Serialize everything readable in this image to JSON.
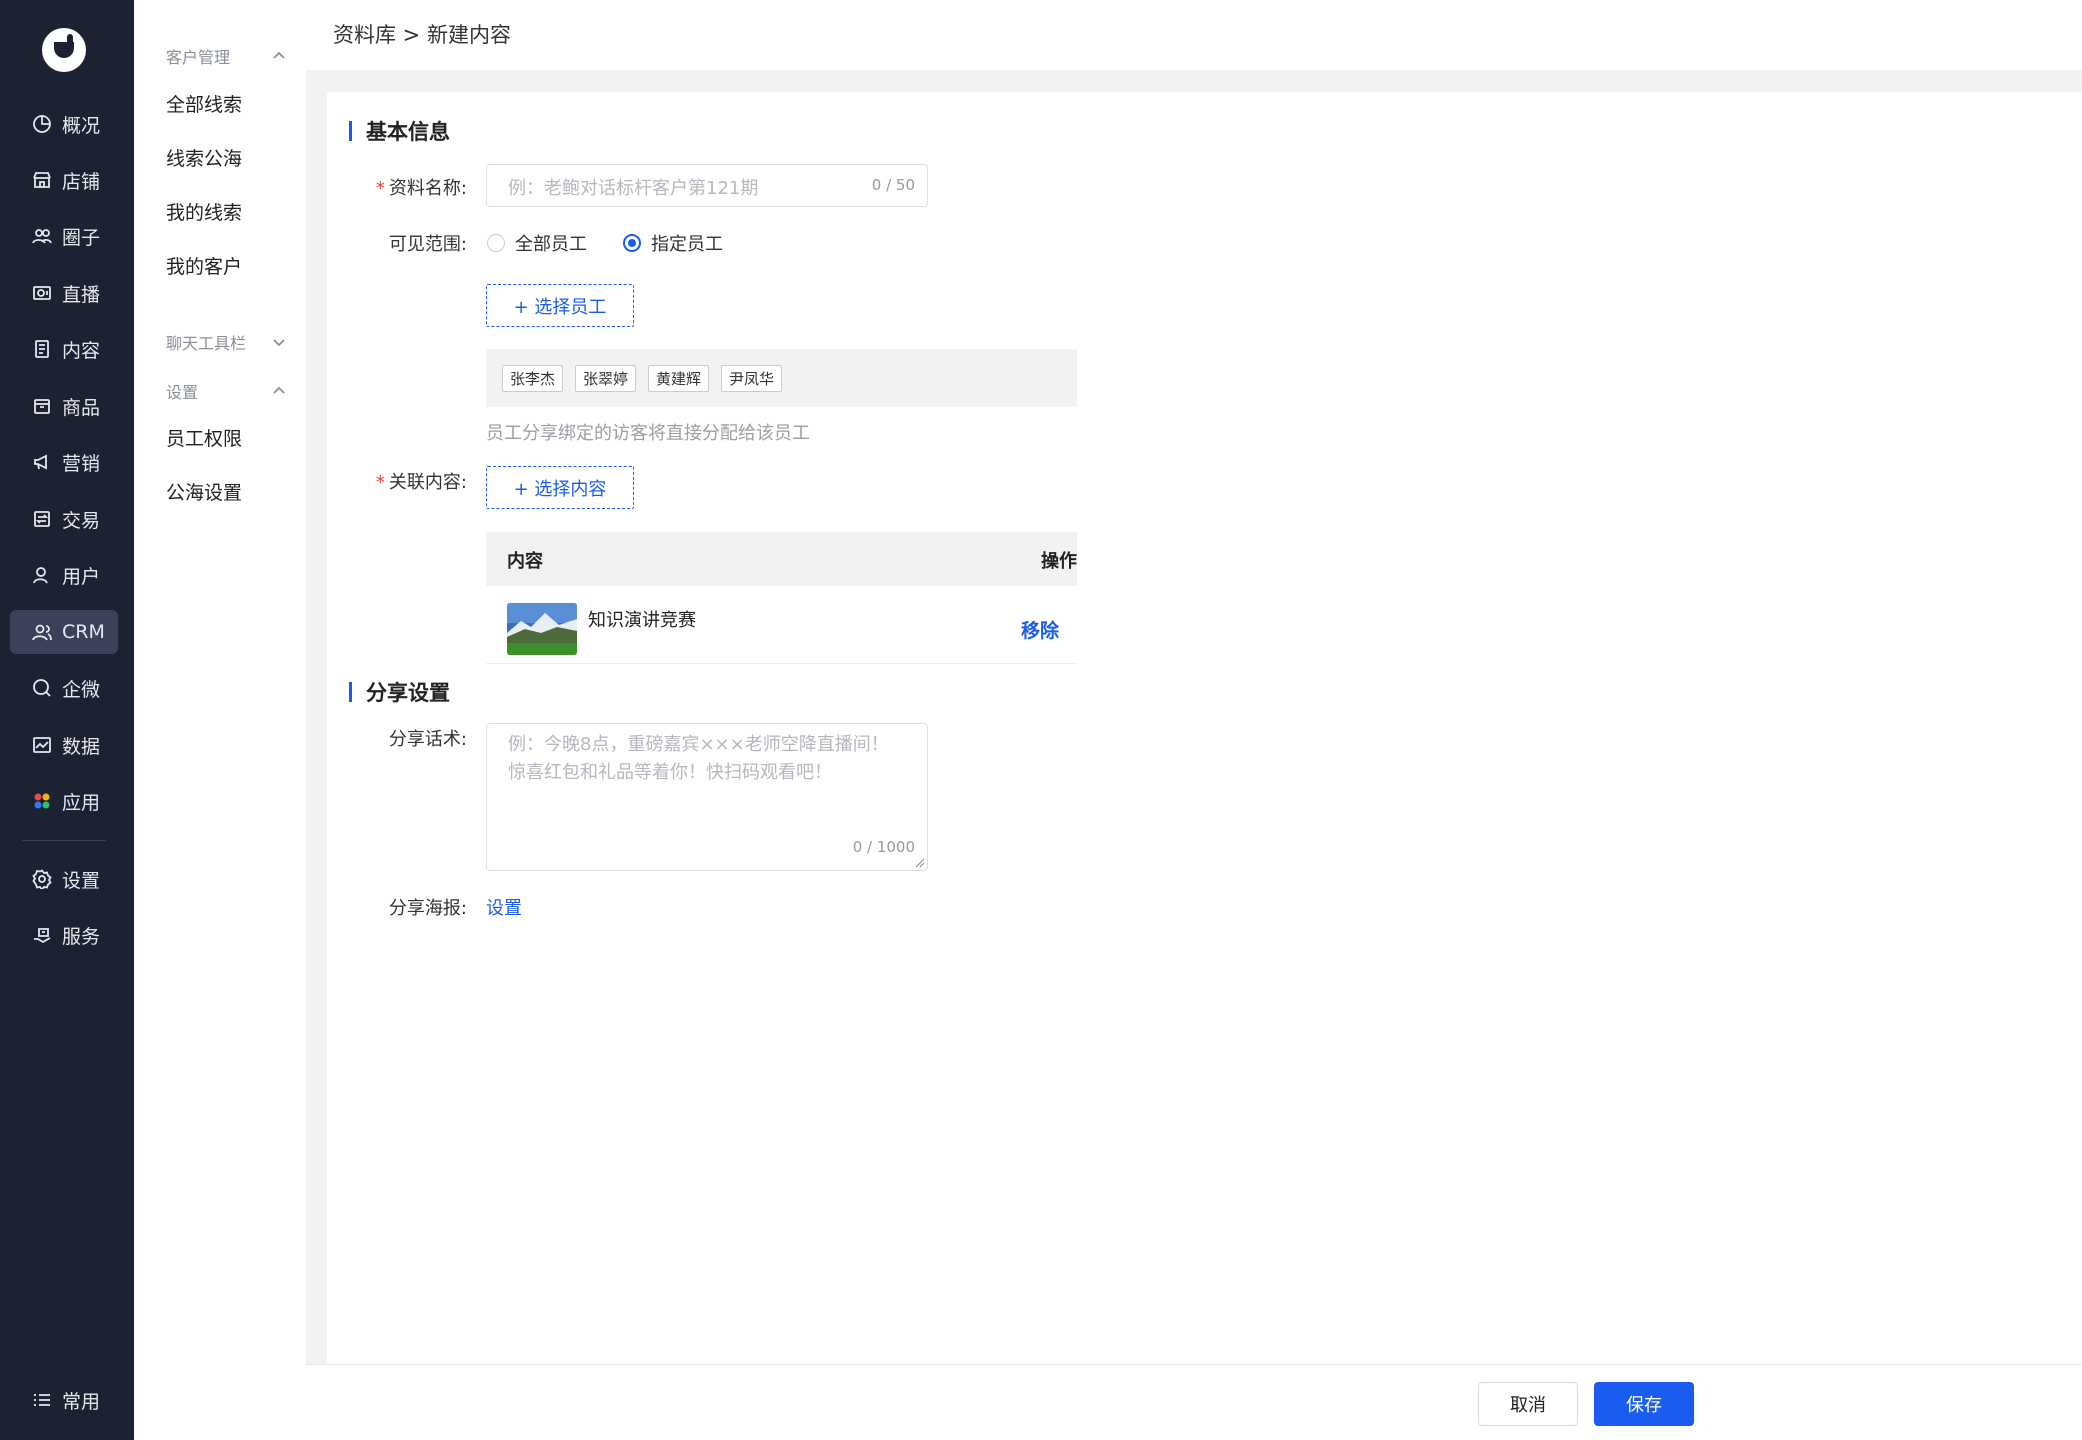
{
  "nav": {
    "items": [
      {
        "label": "概况",
        "icon": "pie-chart-icon"
      },
      {
        "label": "店铺",
        "icon": "store-icon"
      },
      {
        "label": "圈子",
        "icon": "group-icon"
      },
      {
        "label": "直播",
        "icon": "live-icon"
      },
      {
        "label": "内容",
        "icon": "document-icon"
      },
      {
        "label": "商品",
        "icon": "box-icon"
      },
      {
        "label": "营销",
        "icon": "megaphone-icon"
      },
      {
        "label": "交易",
        "icon": "exchange-icon"
      },
      {
        "label": "用户",
        "icon": "user-icon"
      },
      {
        "label": "CRM",
        "icon": "crm-icon"
      },
      {
        "label": "企微",
        "icon": "wecom-icon"
      },
      {
        "label": "数据",
        "icon": "chart-icon"
      },
      {
        "label": "应用",
        "icon": "apps-icon"
      }
    ],
    "bottom_items": [
      {
        "label": "设置",
        "icon": "gear-icon"
      },
      {
        "label": "服务",
        "icon": "service-icon"
      }
    ],
    "footer_label": "常用",
    "active": "CRM"
  },
  "subnav": {
    "group1": "客户管理",
    "group1_items": [
      "全部线索",
      "线索公海",
      "我的线索",
      "我的客户"
    ],
    "group2": "聊天工具栏",
    "group3": "设置",
    "group3_items": [
      "员工权限",
      "公海设置"
    ]
  },
  "breadcrumb": "资料库 > 新建内容",
  "basic": {
    "section_title": "基本信息",
    "name_label": "资料名称:",
    "name_placeholder": "例：老鲍对话标杆客户第121期",
    "name_counter": "0 / 50",
    "scope_label": "可见范围:",
    "scope_options": [
      "全部员工",
      "指定员工"
    ],
    "scope_selected": "指定员工",
    "select_staff_button": "+ 选择员工",
    "staff_tags": [
      "张李杰",
      "张翠婷",
      "黄建辉",
      "尹凤华"
    ],
    "staff_hint": "员工分享绑定的访客将直接分配给该员工",
    "content_label": "关联内容:",
    "select_content_button": "+ 选择内容",
    "table_headers": [
      "内容",
      "操作"
    ],
    "rows": [
      {
        "title": "知识演讲竞赛",
        "action": "移除"
      }
    ]
  },
  "share": {
    "section_title": "分享设置",
    "script_label": "分享话术:",
    "script_placeholder_line1": "例：今晚8点，重磅嘉宾×××老师空降直播间！",
    "script_placeholder_line2": "惊喜红包和礼品等着你！快扫码观看吧！",
    "script_counter": "0 / 1000",
    "poster_label": "分享海报:",
    "poster_link": "设置"
  },
  "footer": {
    "cancel": "取消",
    "save": "保存"
  },
  "colors": {
    "accent": "#1a5cf0",
    "nav_bg": "#1d2233",
    "required": "#f23b3b"
  }
}
